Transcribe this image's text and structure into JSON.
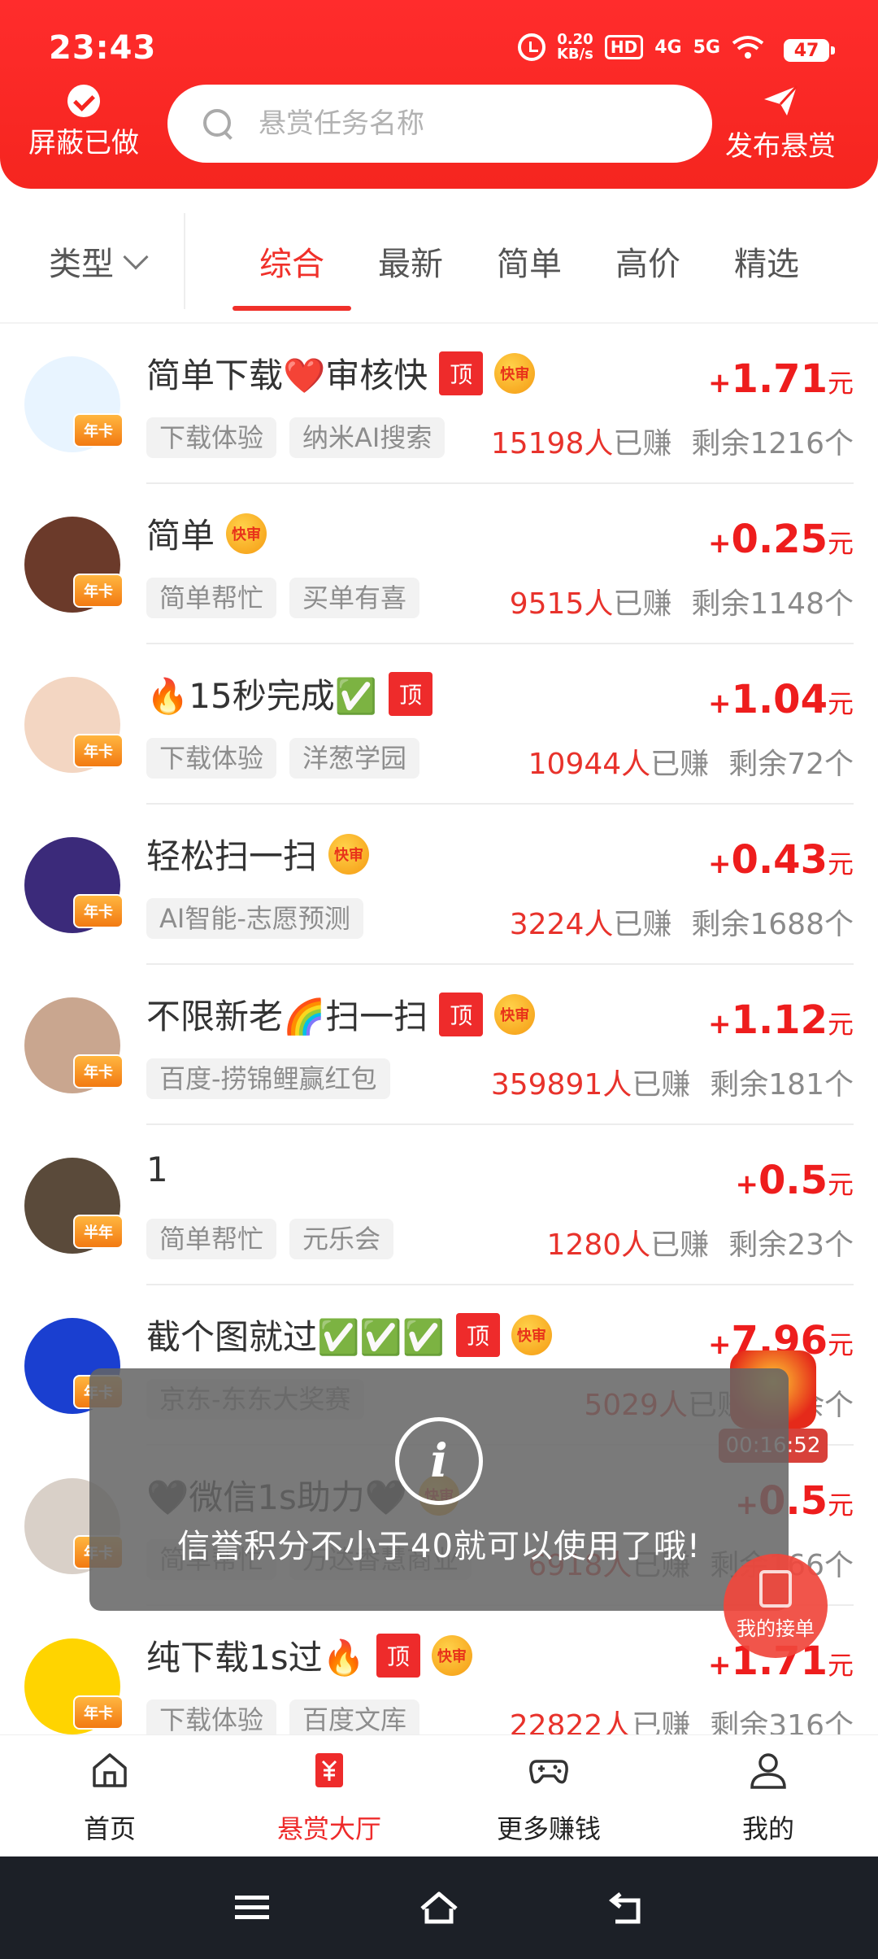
{
  "status": {
    "time": "23:43",
    "speed_value": "0.20",
    "speed_unit": "KB/s",
    "hd": "HD",
    "net1": "4G",
    "net2": "5G",
    "battery": "47"
  },
  "header": {
    "hide_done_label": "屏蔽已做",
    "search_placeholder": "悬赏任务名称",
    "publish_label": "发布悬赏"
  },
  "filter": {
    "type_label": "类型",
    "tabs": [
      "综合",
      "最新",
      "简单",
      "高价",
      "精选"
    ],
    "active_tab": "综合"
  },
  "badges": {
    "top": "顶",
    "fast": "快审"
  },
  "tasks": [
    {
      "title": "简单下载❤️审核快",
      "top": true,
      "fast": true,
      "avatar_badge": "年卡",
      "plus": "+",
      "amount": "1.71",
      "unit": "元",
      "tags": [
        "下载体验",
        "纳米AI搜索"
      ],
      "earned": "15198人",
      "earned_suffix": "已赚",
      "remaining": "剩余1216个",
      "avatar_color": "#e8f4ff"
    },
    {
      "title": "简单",
      "top": false,
      "fast": true,
      "avatar_badge": "年卡",
      "plus": "+",
      "amount": "0.25",
      "unit": "元",
      "tags": [
        "简单帮忙",
        "买单有喜"
      ],
      "earned": "9515人",
      "earned_suffix": "已赚",
      "remaining": "剩余1148个",
      "avatar_color": "#6b3a2a"
    },
    {
      "title": "🔥15秒完成✅",
      "top": true,
      "fast": false,
      "avatar_badge": "年卡",
      "plus": "+",
      "amount": "1.04",
      "unit": "元",
      "tags": [
        "下载体验",
        "洋葱学园"
      ],
      "earned": "10944人",
      "earned_suffix": "已赚",
      "remaining": "剩余72个",
      "avatar_color": "#f3d6c2"
    },
    {
      "title": "轻松扫一扫",
      "top": false,
      "fast": true,
      "avatar_badge": "年卡",
      "plus": "+",
      "amount": "0.43",
      "unit": "元",
      "tags": [
        "AI智能-志愿预测"
      ],
      "earned": "3224人",
      "earned_suffix": "已赚",
      "remaining": "剩余1688个",
      "avatar_color": "#3b2a7a"
    },
    {
      "title": "不限新老🌈扫一扫",
      "top": true,
      "fast": true,
      "avatar_badge": "年卡",
      "plus": "+",
      "amount": "1.12",
      "unit": "元",
      "tags": [
        "百度-捞锦鲤赢红包"
      ],
      "earned": "359891人",
      "earned_suffix": "已赚",
      "remaining": "剩余181个",
      "avatar_color": "#c9a68f"
    },
    {
      "title": "1",
      "top": false,
      "fast": false,
      "avatar_badge": "半年",
      "plus": "+",
      "amount": "0.5",
      "unit": "元",
      "tags": [
        "简单帮忙",
        "元乐会"
      ],
      "earned": "1280人",
      "earned_suffix": "已赚",
      "remaining": "剩余23个",
      "avatar_color": "#5a4a3a"
    },
    {
      "title": "截个图就过✅✅✅",
      "top": true,
      "fast": true,
      "avatar_badge": "年卡",
      "plus": "+",
      "amount": "7.96",
      "unit": "元",
      "tags": [
        "京东-东东大奖赛"
      ],
      "earned": "5029人",
      "earned_suffix": "已赚",
      "remaining": "剩余个",
      "avatar_color": "#1a3fd0"
    },
    {
      "title": "🖤微信1s助力🖤",
      "top": false,
      "fast": true,
      "avatar_badge": "年卡",
      "plus": "+",
      "amount": "0.5",
      "unit": "元",
      "tags": [
        "简单帮忙",
        "万达香慧商业"
      ],
      "earned": "6918人",
      "earned_suffix": "已赚",
      "remaining": "剩余166个",
      "avatar_color": "#d9d0c8"
    },
    {
      "title": "纯下载1s过🔥",
      "top": true,
      "fast": true,
      "avatar_badge": "年卡",
      "plus": "+",
      "amount": "1.71",
      "unit": "元",
      "tags": [
        "下载体验",
        "百度文库"
      ],
      "earned": "22822人",
      "earned_suffix": "已赚",
      "remaining": "剩余316个",
      "avatar_color": "#ffd400"
    }
  ],
  "toast": {
    "message": "信誉积分不小于40就可以使用了哦!"
  },
  "floating": {
    "timer": "00:16:52",
    "my_orders": "我的接单"
  },
  "bottom_nav": [
    {
      "label": "首页",
      "icon": "home-icon"
    },
    {
      "label": "悬赏大厅",
      "icon": "reward-hall-icon"
    },
    {
      "label": "更多赚钱",
      "icon": "gamepad-icon"
    },
    {
      "label": "我的",
      "icon": "user-icon"
    }
  ],
  "active_nav": "悬赏大厅",
  "colors": {
    "brand": "#f5251f",
    "price": "#ee1d1d",
    "nav_bar": "#1c2027"
  }
}
